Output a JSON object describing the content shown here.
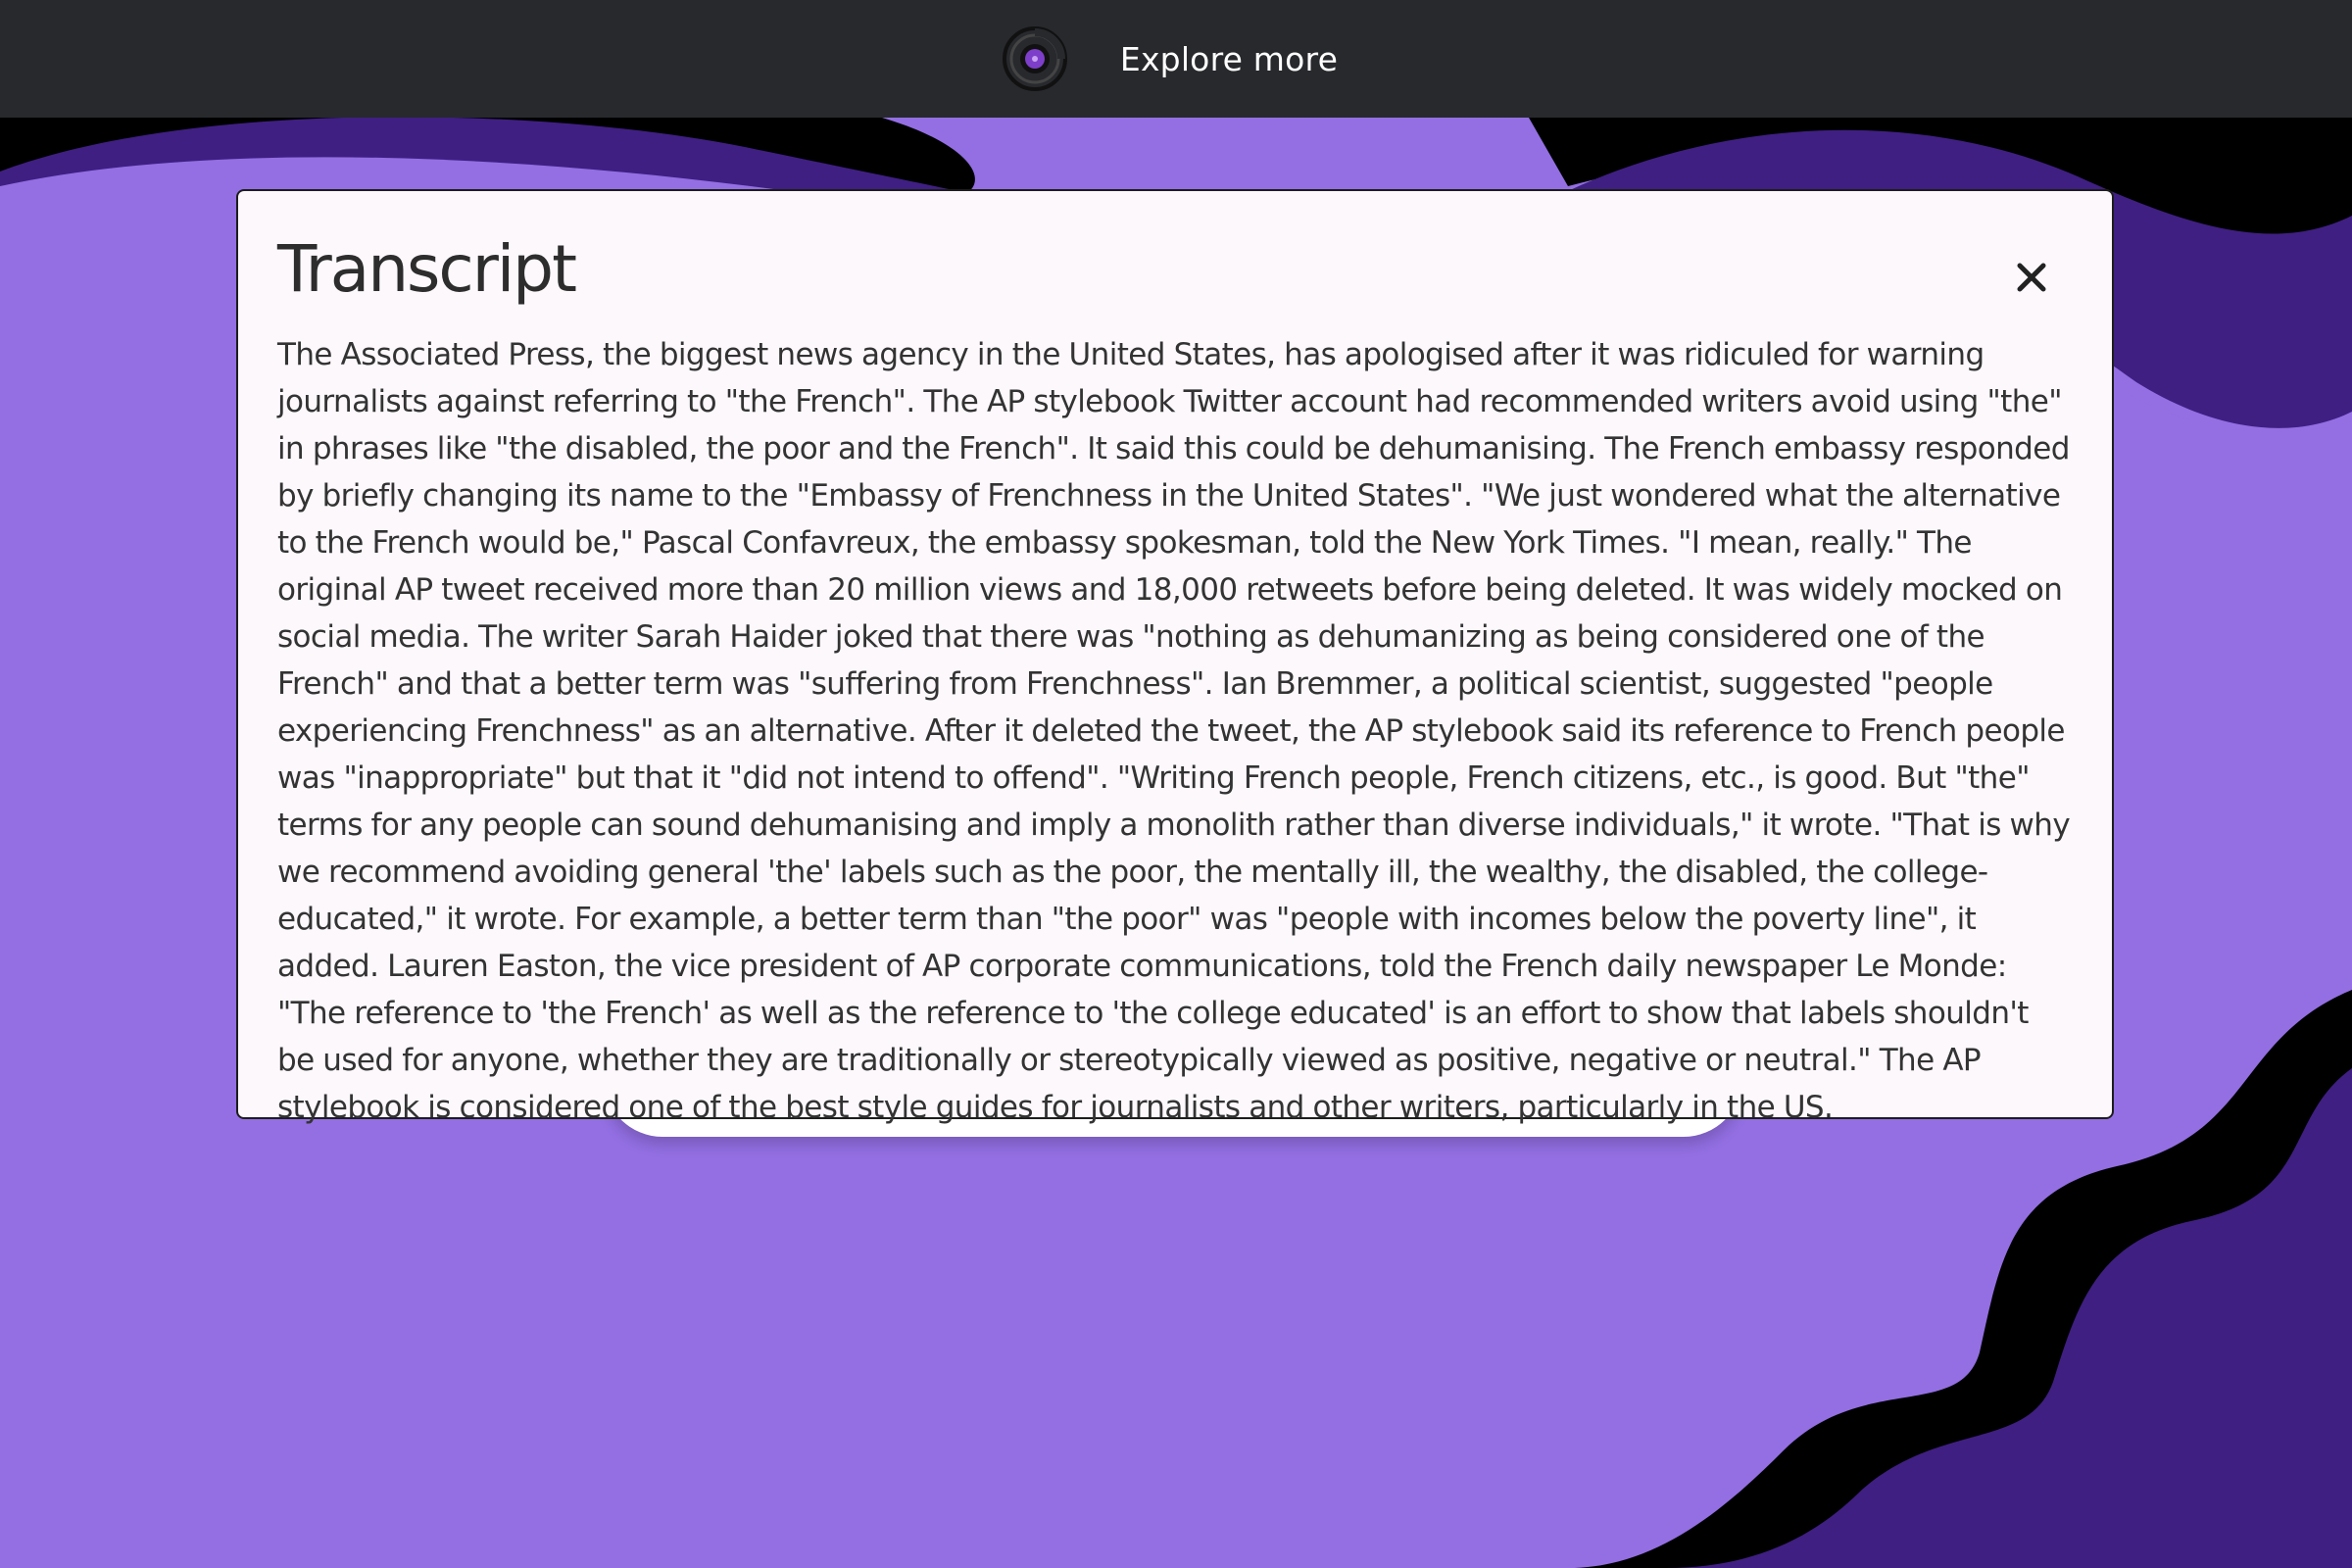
{
  "topbar": {
    "logo_icon": "camera-lens-logo-icon",
    "explore_label": "Explore more"
  },
  "modal": {
    "title": "Transcript",
    "close_icon": "close-icon",
    "transcript": "The Associated Press, the biggest news agency in the United States, has apologised after it was ridiculed for warning journalists against referring to \"the French\". The AP stylebook Twitter account had recommended writers avoid using \"the\" in phrases like \"the disabled, the poor and the French\". It said this could be dehumanising. The French embassy responded by briefly changing its name to the \"Embassy of Frenchness in the United States\". \"We just wondered what the alternative to the French would be,\" Pascal Confavreux, the embassy spokesman, told the New York Times. \"I mean, really.\" The original AP tweet received more than 20 million views and 18,000 retweets before being deleted. It was widely mocked on social media. The writer Sarah Haider joked that there was \"nothing as dehumanizing as being considered one of the French\" and that a better term was \"suffering from Frenchness\". Ian Bremmer, a political scientist, suggested \"people experiencing Frenchness\" as an alternative. After it deleted the tweet, the AP stylebook said its reference to French people was \"inappropriate\" but that it \"did not intend to offend\". \"Writing French people, French citizens, etc., is good. But \"the\" terms for any people can sound dehumanising and imply a monolith rather than diverse individuals,\" it wrote. \"That is why we recommend avoiding general 'the' labels such as the poor, the mentally ill, the wealthy, the disabled, the college-educated,\" it wrote. For example, a better term than \"the poor\" was \"people with incomes below the poverty line\", it added. Lauren Easton, the vice president of AP corporate communications, told the French daily newspaper Le Monde: \"The reference to 'the French' as well as the reference to 'the college educated' is an effort to show that labels shouldn't be used for anyone, whether they are traditionally or stereotypically viewed as positive, negative or neutral.\" The AP stylebook is considered one of the best style guides for journalists and other writers, particularly in the US."
  },
  "colors": {
    "topbar_bg": "#27292d",
    "background_purple": "#936fe3",
    "wave_dark_purple": "#3f1f82",
    "wave_black": "#000000",
    "modal_bg": "#fcf8fc",
    "text": "#333333"
  }
}
